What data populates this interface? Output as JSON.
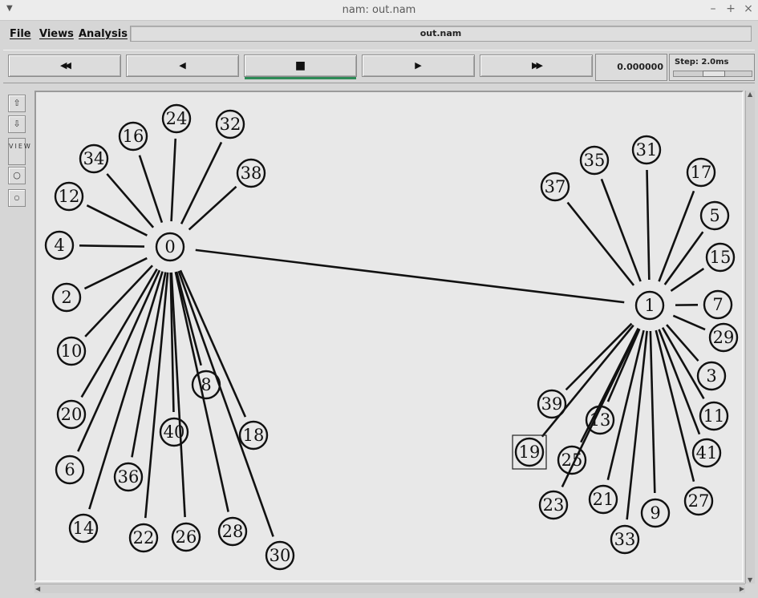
{
  "window": {
    "title": "nam: out.nam"
  },
  "menubar": {
    "items": [
      "File",
      "Views",
      "Analysis"
    ],
    "file_name": "out.nam"
  },
  "toolbar": {
    "buttons": [
      {
        "name": "fast-rewind",
        "glyph": "◀◀"
      },
      {
        "name": "rewind",
        "glyph": "◀"
      },
      {
        "name": "stop",
        "glyph": "■"
      },
      {
        "name": "play",
        "glyph": "▶"
      },
      {
        "name": "fast-forward",
        "glyph": "▶▶"
      }
    ],
    "time": "0.000000",
    "step_label": "Step: 2.0ms",
    "step_slider_fraction": 0.5
  },
  "palette": {
    "view_text": "VIEW"
  },
  "topology": {
    "hubs": [
      "0",
      "1"
    ],
    "links": [
      [
        "0",
        "1"
      ],
      [
        "0",
        "24"
      ],
      [
        "0",
        "32"
      ],
      [
        "0",
        "16"
      ],
      [
        "0",
        "38"
      ],
      [
        "0",
        "34"
      ],
      [
        "0",
        "12"
      ],
      [
        "0",
        "4"
      ],
      [
        "0",
        "2"
      ],
      [
        "0",
        "10"
      ],
      [
        "0",
        "20"
      ],
      [
        "0",
        "6"
      ],
      [
        "0",
        "14"
      ],
      [
        "0",
        "36"
      ],
      [
        "0",
        "22"
      ],
      [
        "0",
        "40"
      ],
      [
        "0",
        "26"
      ],
      [
        "0",
        "8"
      ],
      [
        "0",
        "28"
      ],
      [
        "0",
        "18"
      ],
      [
        "0",
        "30"
      ],
      [
        "1",
        "31"
      ],
      [
        "1",
        "35"
      ],
      [
        "1",
        "17"
      ],
      [
        "1",
        "37"
      ],
      [
        "1",
        "5"
      ],
      [
        "1",
        "15"
      ],
      [
        "1",
        "7"
      ],
      [
        "1",
        "29"
      ],
      [
        "1",
        "3"
      ],
      [
        "1",
        "11"
      ],
      [
        "1",
        "41"
      ],
      [
        "1",
        "27"
      ],
      [
        "1",
        "9"
      ],
      [
        "1",
        "33"
      ],
      [
        "1",
        "21"
      ],
      [
        "1",
        "25"
      ],
      [
        "1",
        "13"
      ],
      [
        "1",
        "23"
      ],
      [
        "1",
        "39"
      ],
      [
        "1",
        "19"
      ]
    ],
    "nodes": [
      "0",
      "1",
      "24",
      "32",
      "16",
      "38",
      "34",
      "12",
      "4",
      "2",
      "10",
      "20",
      "6",
      "14",
      "36",
      "22",
      "40",
      "26",
      "8",
      "28",
      "18",
      "30",
      "31",
      "35",
      "17",
      "37",
      "5",
      "15",
      "7",
      "29",
      "3",
      "11",
      "41",
      "27",
      "9",
      "33",
      "21",
      "25",
      "13",
      "23",
      "39",
      "19"
    ],
    "selected_node": "19"
  }
}
